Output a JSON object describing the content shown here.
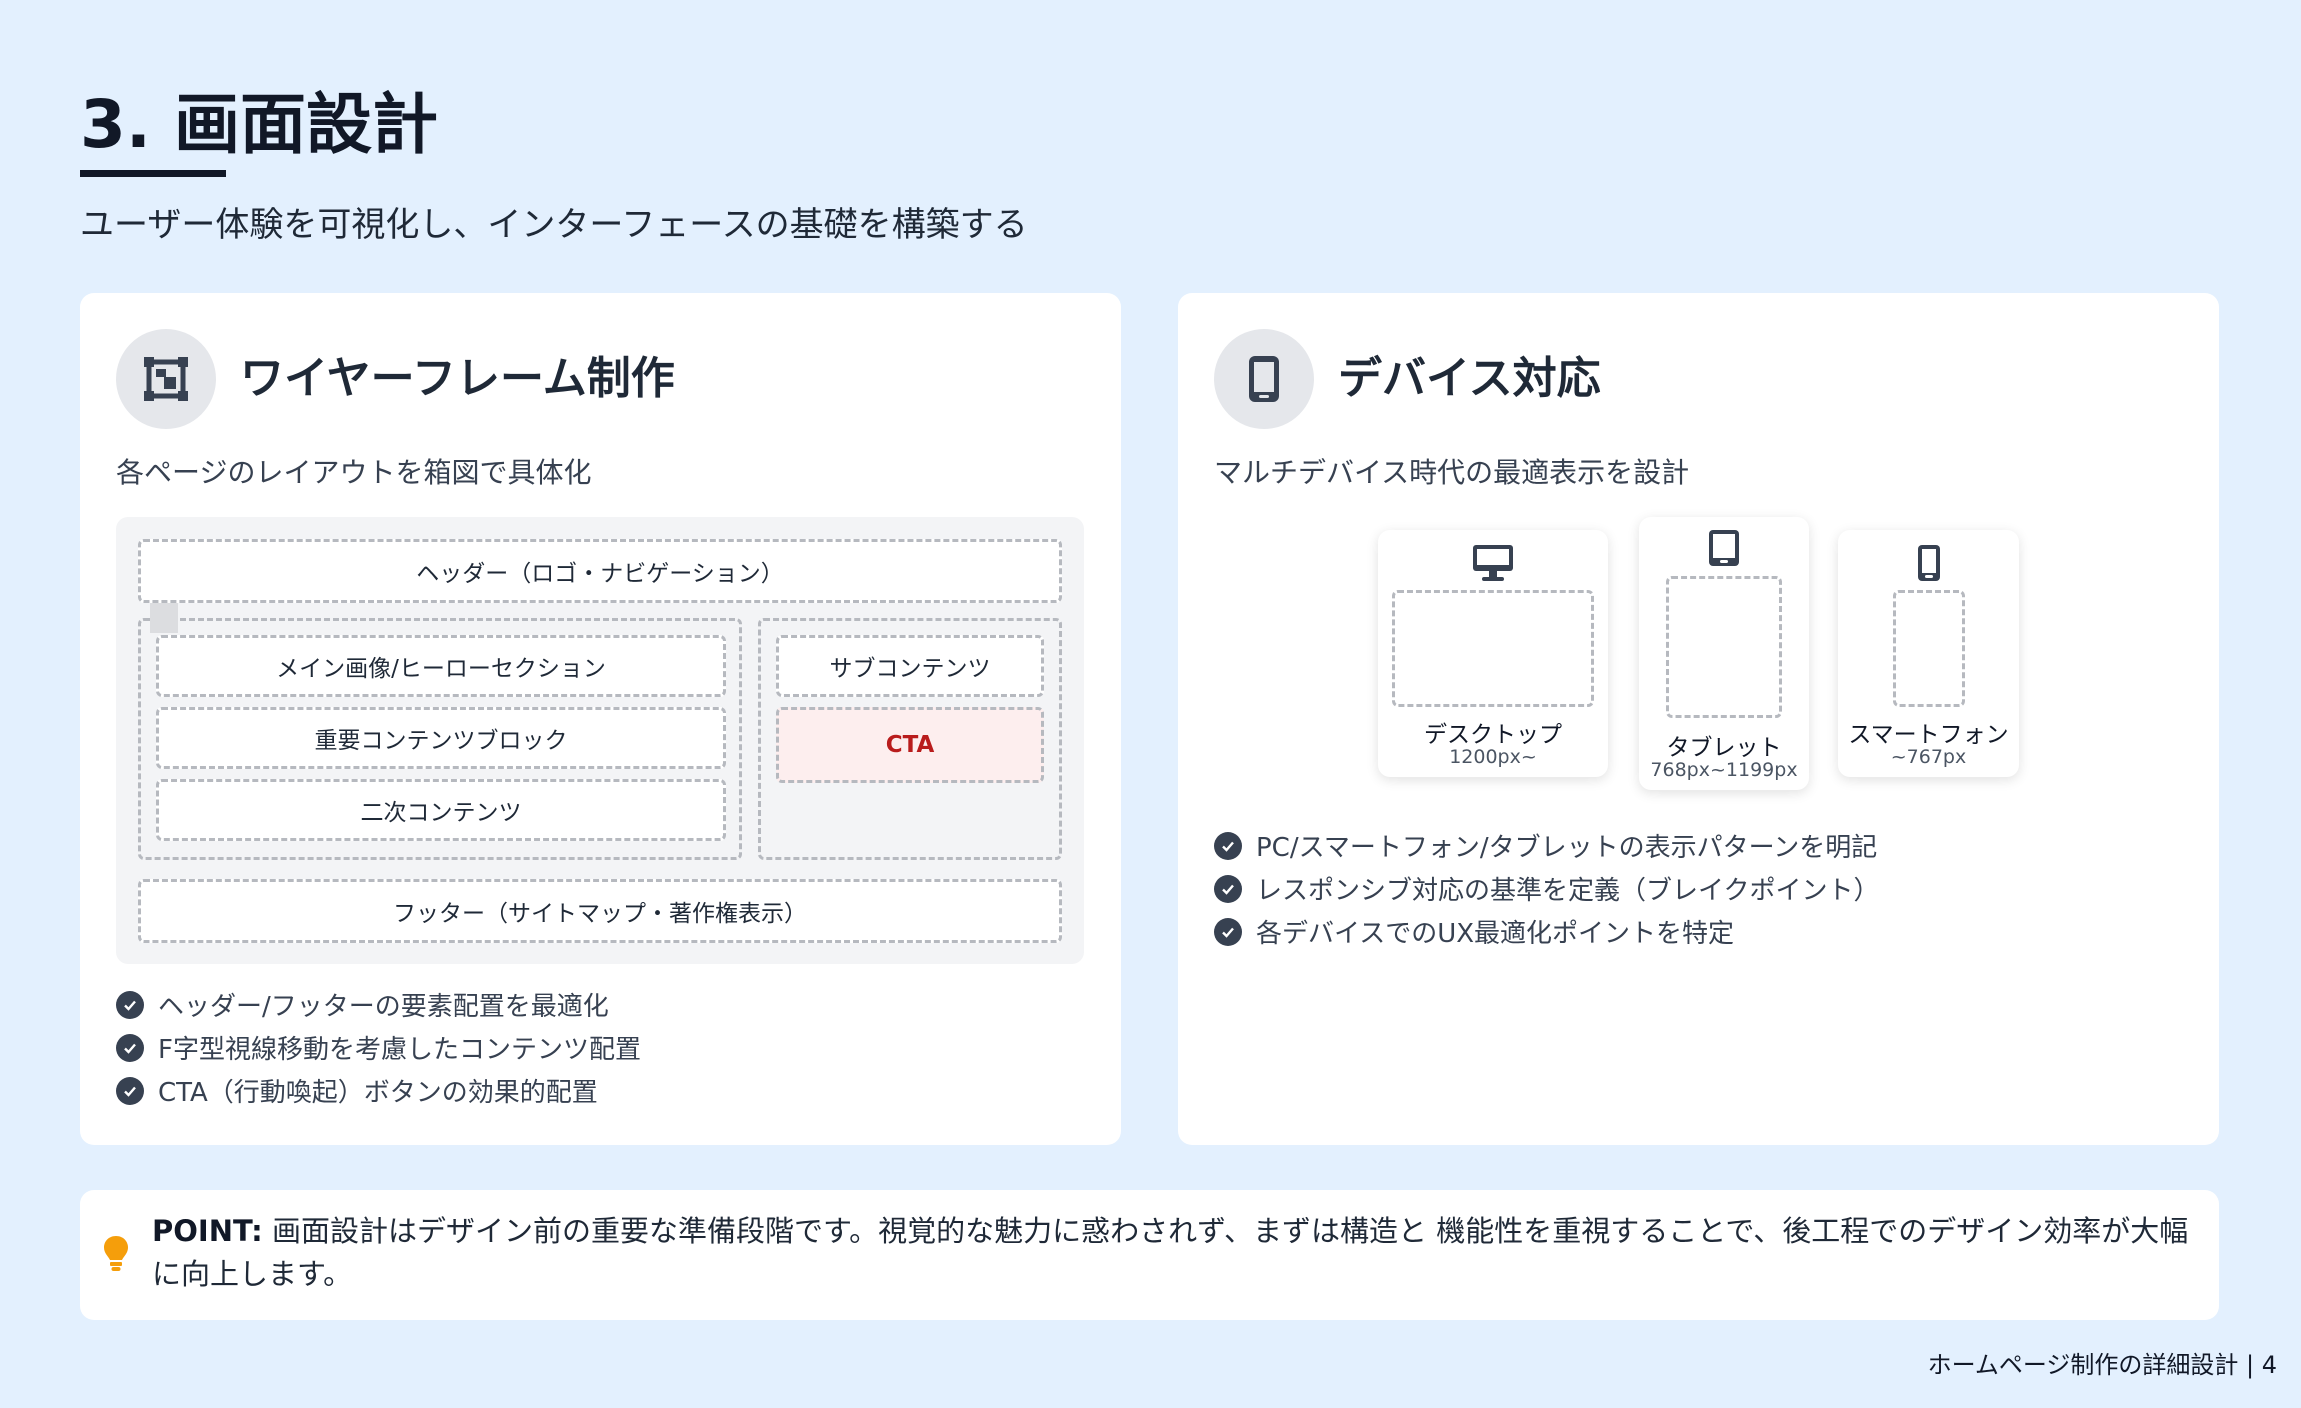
{
  "header": {
    "title": "3. 画面設計",
    "subtitle": "ユーザー体験を可視化し、インターフェースの基礎を構築する"
  },
  "wireframe_card": {
    "icon": "wireframe-icon",
    "heading": "ワイヤーフレーム制作",
    "description": "各ページのレイアウトを箱図で具体化",
    "wireframe": {
      "header": "ヘッダー（ロゴ・ナビゲーション）",
      "main_items": [
        "メイン画像/ヒーローセクション",
        "重要コンテンツブロック",
        "二次コンテンツ"
      ],
      "sub": "サブコンテンツ",
      "cta": "CTA",
      "footer": "フッター（サイトマップ・著作権表示）"
    },
    "points": [
      "ヘッダー/フッターの要素配置を最適化",
      "F字型視線移動を考慮したコンテンツ配置",
      "CTA（行動喚起）ボタンの効果的配置"
    ]
  },
  "device_card": {
    "icon": "mobile-icon",
    "heading": "デバイス対応",
    "description": "マルチデバイス時代の最適表示を設計",
    "devices": [
      {
        "name": "デスクトップ",
        "size": "1200px~",
        "icon": "desktop-icon"
      },
      {
        "name": "タブレット",
        "size": "768px~1199px",
        "icon": "tablet-icon"
      },
      {
        "name": "スマートフォン",
        "size": "~767px",
        "icon": "smartphone-icon"
      }
    ],
    "points": [
      "PC/スマートフォン/タブレットの表示パターンを明記",
      "レスポンシブ対応の基準を定義（ブレイクポイント）",
      "各デバイスでのUX最適化ポイントを特定"
    ]
  },
  "point": {
    "label": "POINT:",
    "text": "画面設計はデザイン前の重要な準備段階です。視覚的な魅力に惑わされず、まずは構造と 機能性を重視することで、後工程でのデザイン効率が大幅に向上します。",
    "icon": "lightbulb-icon",
    "icon_color": "#f59e0b"
  },
  "footer": {
    "note": "ホームページ制作の詳細設計 | 4"
  },
  "colors": {
    "background": "#e3f0fe",
    "cta": "#b91c1c",
    "cta_bg": "#fdeeee"
  }
}
